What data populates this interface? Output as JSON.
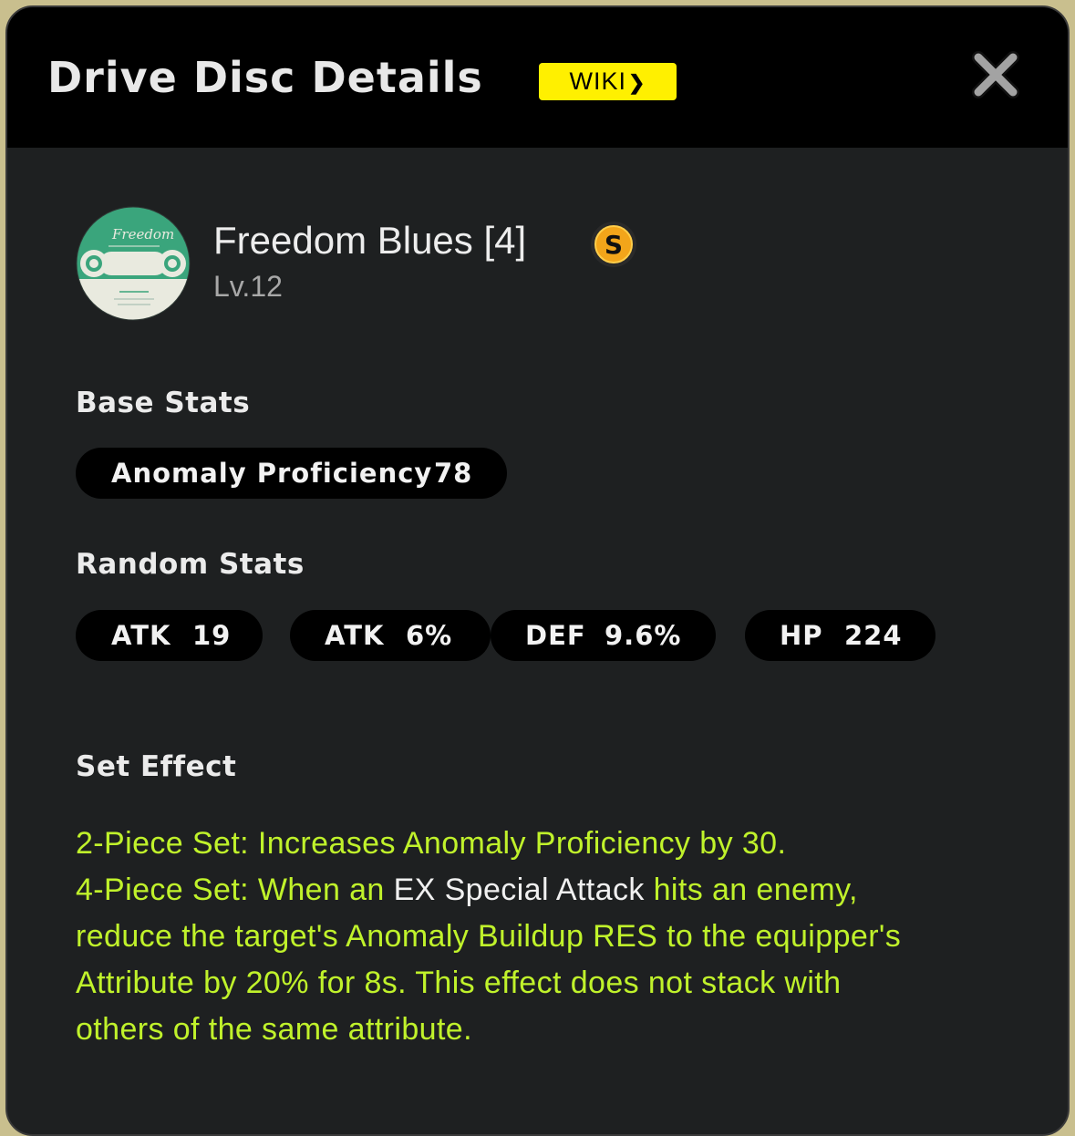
{
  "header": {
    "title": "Drive Disc Details",
    "wiki_label": "WIKI",
    "wiki_chevron": "❯"
  },
  "disc": {
    "name": "Freedom Blues [4]",
    "level": "Lv.12",
    "rank": "S",
    "art_title": "Freedom"
  },
  "base_stats": {
    "label": "Base Stats",
    "items": [
      {
        "name": "Anomaly Proficiency",
        "value": "78"
      }
    ]
  },
  "random_stats": {
    "label": "Random Stats",
    "items": [
      {
        "name": "ATK",
        "value": "19"
      },
      {
        "name": "ATK",
        "value": "6%"
      },
      {
        "name": "DEF",
        "value": "9.6%"
      },
      {
        "name": "HP",
        "value": "224"
      }
    ]
  },
  "set_effect": {
    "label": "Set Effect",
    "two_piece": "2-Piece Set: Increases Anomaly Proficiency by 30.",
    "four_piece_a": "4-Piece Set: When an ",
    "four_piece_highlight": "EX Special Attack",
    "four_piece_b": " hits an enemy,",
    "four_piece_line2": "reduce the target's Anomaly Buildup RES to the equipper's",
    "four_piece_line3": "Attribute by 20% for 8s. This effect does not stack with",
    "four_piece_line4": "others of the same attribute."
  },
  "colors": {
    "accent_yellow": "#fff000",
    "effect_green": "#c0f22b",
    "disc_green": "#3aa57c",
    "background": "#1e2021"
  }
}
